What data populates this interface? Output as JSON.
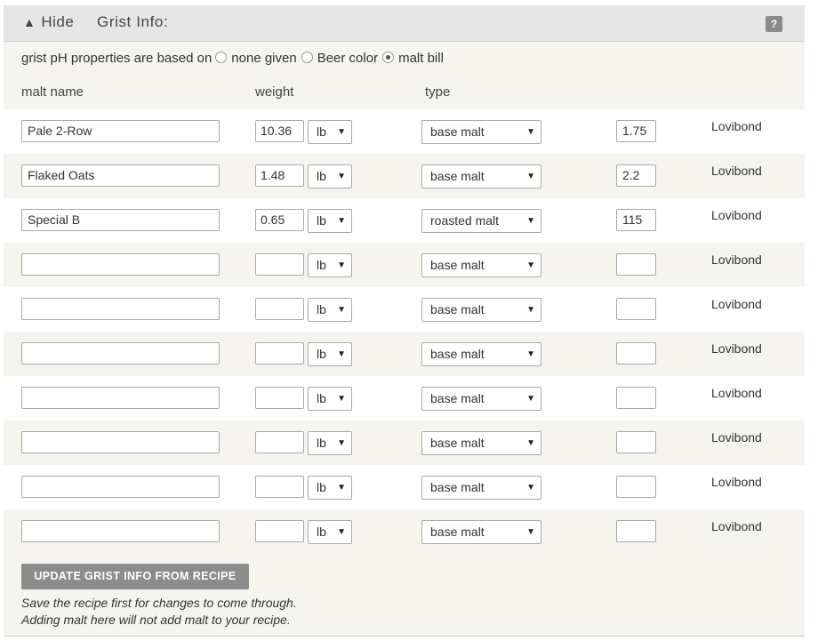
{
  "header": {
    "toggle_icon": "▲",
    "toggle_label": "Hide",
    "title": "Grist Info:",
    "help_label": "?"
  },
  "ph": {
    "prefix": "grist pH properties are based on",
    "options": [
      {
        "label": "none given",
        "checked": false
      },
      {
        "label": "Beer color",
        "checked": false
      },
      {
        "label": "malt bill",
        "checked": true
      }
    ]
  },
  "columns": {
    "name": "malt name",
    "weight": "weight",
    "type": "type"
  },
  "rows": [
    {
      "name": "Pale 2-Row",
      "weight": "10.36",
      "unit": "lb",
      "type": "base malt",
      "color": "1.75",
      "color_unit": "Lovibond"
    },
    {
      "name": "Flaked Oats",
      "weight": "1.48",
      "unit": "lb",
      "type": "base malt",
      "color": "2.2",
      "color_unit": "Lovibond"
    },
    {
      "name": "Special B",
      "weight": "0.65",
      "unit": "lb",
      "type": "roasted malt",
      "color": "115",
      "color_unit": "Lovibond"
    },
    {
      "name": "",
      "weight": "",
      "unit": "lb",
      "type": "base malt",
      "color": "",
      "color_unit": "Lovibond"
    },
    {
      "name": "",
      "weight": "",
      "unit": "lb",
      "type": "base malt",
      "color": "",
      "color_unit": "Lovibond"
    },
    {
      "name": "",
      "weight": "",
      "unit": "lb",
      "type": "base malt",
      "color": "",
      "color_unit": "Lovibond"
    },
    {
      "name": "",
      "weight": "",
      "unit": "lb",
      "type": "base malt",
      "color": "",
      "color_unit": "Lovibond"
    },
    {
      "name": "",
      "weight": "",
      "unit": "lb",
      "type": "base malt",
      "color": "",
      "color_unit": "Lovibond"
    },
    {
      "name": "",
      "weight": "",
      "unit": "lb",
      "type": "base malt",
      "color": "",
      "color_unit": "Lovibond"
    },
    {
      "name": "",
      "weight": "",
      "unit": "lb",
      "type": "base malt",
      "color": "",
      "color_unit": "Lovibond"
    }
  ],
  "select_arrow": "▼",
  "update_button": "UPDATE GRIST INFO FROM RECIPE",
  "notes": [
    "Save the recipe first for changes to come through.",
    "Adding malt here will not add malt to your recipe."
  ]
}
